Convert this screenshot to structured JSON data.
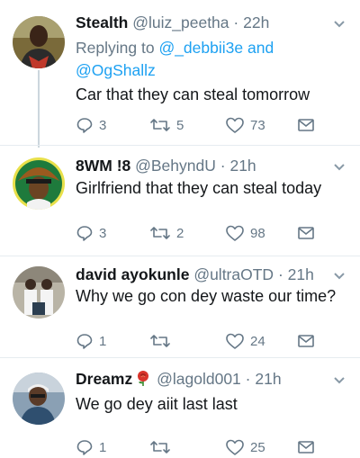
{
  "tweets": [
    {
      "name": "Stealth",
      "handle": "@luiz_peetha",
      "separator": "·",
      "time": "22h",
      "replying_prefix": "Replying to",
      "replying_handle_1": "@_debbii3e",
      "replying_and": "and",
      "replying_handle_2": "@OgShallz",
      "text": "Car that they can steal tomorrow",
      "replies": "3",
      "retweets": "5",
      "likes": "73"
    },
    {
      "name": "8WM !8",
      "handle": "@BehyndU",
      "separator": "·",
      "time": "21h",
      "text": "Girlfriend that they can steal today",
      "replies": "3",
      "retweets": "2",
      "likes": "98"
    },
    {
      "name": "david ayokunle",
      "handle": "@ultraOTD",
      "separator": "·",
      "time": "21h",
      "text": "Why we go con dey waste our time?",
      "replies": "1",
      "retweets": "",
      "likes": "24"
    },
    {
      "name": "Dreamz",
      "handle": "@lagold001",
      "separator": "·",
      "time": "21h",
      "text": "We go dey aiit last last",
      "replies": "1",
      "retweets": "",
      "likes": "25"
    }
  ],
  "icons": {
    "reply": "reply-icon",
    "retweet": "retweet-icon",
    "like": "heart-icon",
    "message": "envelope-icon",
    "more": "chevron-down-icon",
    "name_emoji": "rose-icon"
  },
  "colors": {
    "link": "#1da1f2",
    "secondary_text": "#657786",
    "thread_line": "#ccd6dd",
    "divider": "#e6ecf0"
  }
}
